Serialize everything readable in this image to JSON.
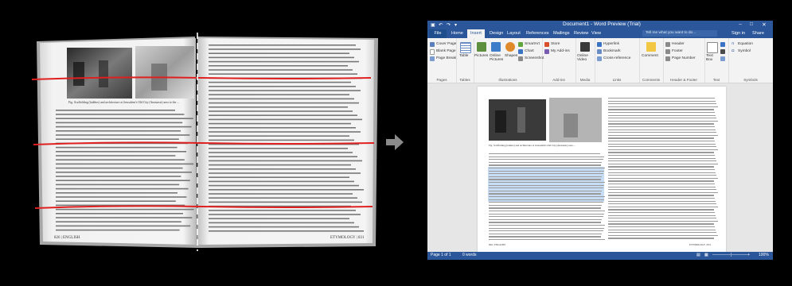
{
  "book": {
    "left_caption": "Fig. Scaffolding (ladders) and architecture at Jerusalem's Old City (Anastasis) area to the ...",
    "left_footer": "826 | ENGLISH",
    "right_footer": "ETYMOLOGY | 831",
    "line_color": "#e02020"
  },
  "word": {
    "title": "Document1 - Word Preview (Trial)",
    "sign_in": "Sign in",
    "share": "Share",
    "tabs": {
      "file": "File",
      "home": "Home",
      "insert": "Insert",
      "design": "Design",
      "layout": "Layout",
      "references": "References",
      "mailings": "Mailings",
      "review": "Review",
      "view": "View"
    },
    "tell_me": "Tell me what you want to do...",
    "ribbon": {
      "pages": {
        "label": "Pages",
        "items": [
          "Cover Page",
          "Blank Page",
          "Page Break"
        ]
      },
      "tables": {
        "label": "Tables",
        "item": "Table"
      },
      "illustrations": {
        "label": "Illustrations",
        "items": [
          "Pictures",
          "Online Pictures",
          "Shapes"
        ],
        "small": [
          "SmartArt",
          "Chart",
          "Screenshot"
        ]
      },
      "addins": {
        "label": "Add-ins",
        "items": [
          "Store",
          "My Add-ins"
        ]
      },
      "media": {
        "label": "Media",
        "item": "Online Video"
      },
      "links": {
        "label": "Links",
        "items": [
          "Hyperlink",
          "Bookmark",
          "Cross-reference"
        ]
      },
      "comments": {
        "label": "Comments",
        "item": "Comment"
      },
      "header_footer": {
        "label": "Header & Footer",
        "items": [
          "Header",
          "Footer",
          "Page Number"
        ]
      },
      "text": {
        "label": "Text",
        "items": [
          "Text Box"
        ]
      },
      "symbols": {
        "label": "Symbols",
        "items": [
          "Equation",
          "Symbol"
        ]
      }
    },
    "doc": {
      "caption": "Fig. Scaffolding (ladders) and architecture at Jerusalem's Old City (Anastasis) area ...",
      "footer_left": "826 | ENGLISH",
      "footer_right": "ETYMOLOGY | 831"
    },
    "status": {
      "page": "Page 1 of 1",
      "words": "0 words",
      "zoom": "100%"
    },
    "accent": "#2b579a"
  }
}
